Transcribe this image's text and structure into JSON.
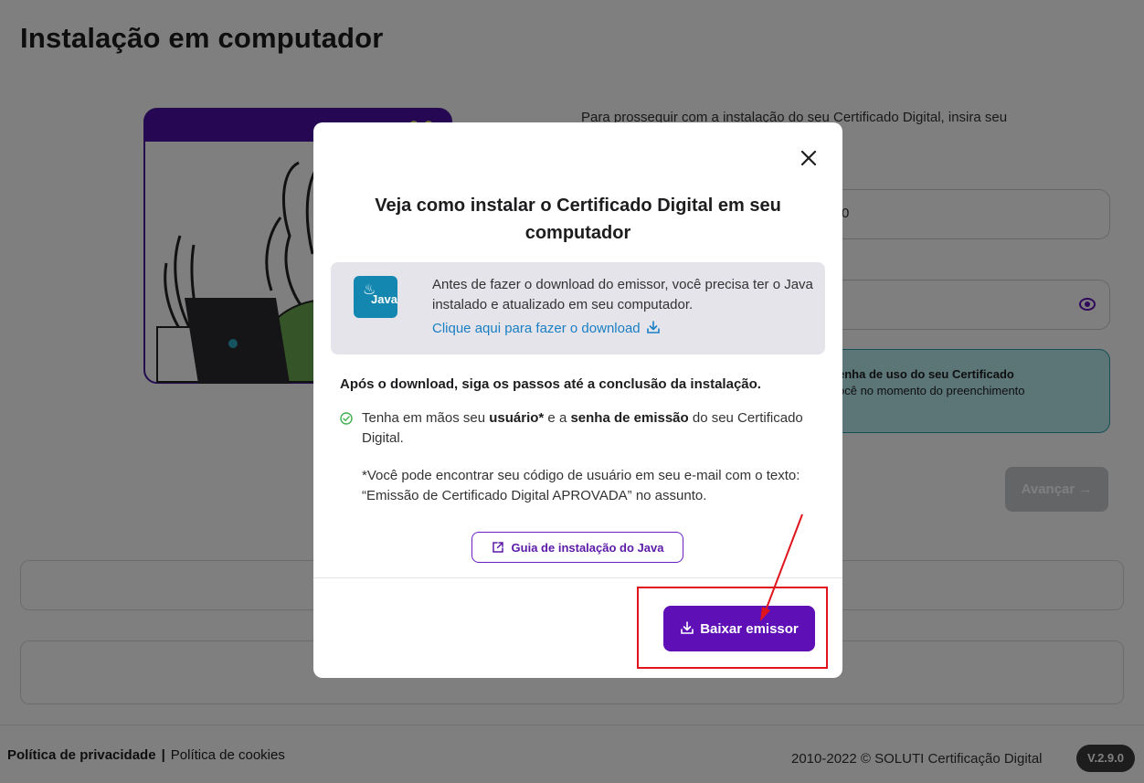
{
  "page": {
    "title": "Instalação em computador",
    "intro_text": "Para prosseguir com a instalação do seu Certificado Digital, insira seu",
    "cpf_partial": "0",
    "info_line1": "enha de uso do seu Certificado",
    "info_line2": "ocê no momento do preenchimento",
    "next_button": "Avançar →"
  },
  "footer": {
    "privacy": "Política de privacidade",
    "separator": "|",
    "cookies": "Política de cookies",
    "copyright": "2010-2022 © SOLUTI Certificação Digital",
    "version": "V.2.9.0"
  },
  "modal": {
    "title": "Veja como instalar o Certificado Digital em seu computador",
    "java_logo_text": "Java",
    "java_info": "Antes de fazer o download do emissor, você precisa ter o Java instalado e atualizado em seu computador.",
    "java_link": "Clique aqui para fazer o download",
    "steps_title": "Após o download, siga os passos até a conclusão da instalação.",
    "step1_pre": "Tenha em mãos seu ",
    "step1_user": "usuário*",
    "step1_mid": " e a ",
    "step1_pass": "senha de emissão",
    "step1_post": " do seu Certificado Digital.",
    "note": "*Você pode encontrar seu código de usuário em seu e-mail com o texto: “Emissão de Certificado Digital APROVADA” no assunto.",
    "guide_button": "Guia de instalação do Java",
    "download_button": "Baixar emissor"
  },
  "colors": {
    "primary": "#5e10b6",
    "java_blue": "#1387b0",
    "link": "#1b7fc4",
    "info_bg": "#b9ebef",
    "annotation_red": "#e0141c"
  },
  "icons": {
    "close": "close-icon",
    "download": "download-icon",
    "external": "external-link-icon",
    "check": "check-circle-icon",
    "eye": "eye-icon"
  }
}
